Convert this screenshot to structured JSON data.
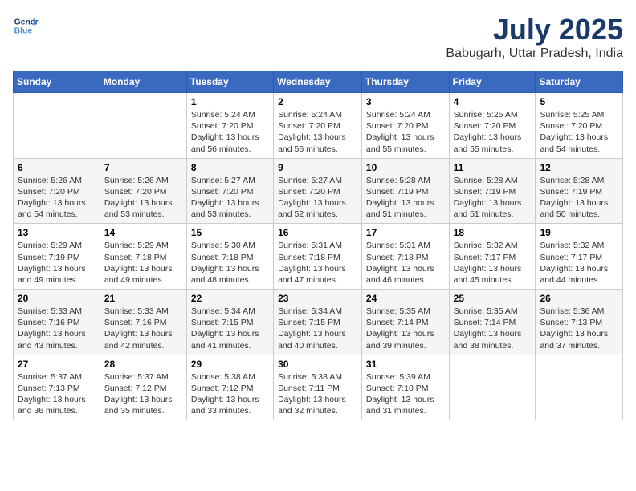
{
  "header": {
    "logo_line1": "General",
    "logo_line2": "Blue",
    "month": "July 2025",
    "location": "Babugarh, Uttar Pradesh, India"
  },
  "weekdays": [
    "Sunday",
    "Monday",
    "Tuesday",
    "Wednesday",
    "Thursday",
    "Friday",
    "Saturday"
  ],
  "weeks": [
    [
      {
        "day": "",
        "info": ""
      },
      {
        "day": "",
        "info": ""
      },
      {
        "day": "1",
        "info": "Sunrise: 5:24 AM\nSunset: 7:20 PM\nDaylight: 13 hours and 56 minutes."
      },
      {
        "day": "2",
        "info": "Sunrise: 5:24 AM\nSunset: 7:20 PM\nDaylight: 13 hours and 56 minutes."
      },
      {
        "day": "3",
        "info": "Sunrise: 5:24 AM\nSunset: 7:20 PM\nDaylight: 13 hours and 55 minutes."
      },
      {
        "day": "4",
        "info": "Sunrise: 5:25 AM\nSunset: 7:20 PM\nDaylight: 13 hours and 55 minutes."
      },
      {
        "day": "5",
        "info": "Sunrise: 5:25 AM\nSunset: 7:20 PM\nDaylight: 13 hours and 54 minutes."
      }
    ],
    [
      {
        "day": "6",
        "info": "Sunrise: 5:26 AM\nSunset: 7:20 PM\nDaylight: 13 hours and 54 minutes."
      },
      {
        "day": "7",
        "info": "Sunrise: 5:26 AM\nSunset: 7:20 PM\nDaylight: 13 hours and 53 minutes."
      },
      {
        "day": "8",
        "info": "Sunrise: 5:27 AM\nSunset: 7:20 PM\nDaylight: 13 hours and 53 minutes."
      },
      {
        "day": "9",
        "info": "Sunrise: 5:27 AM\nSunset: 7:20 PM\nDaylight: 13 hours and 52 minutes."
      },
      {
        "day": "10",
        "info": "Sunrise: 5:28 AM\nSunset: 7:19 PM\nDaylight: 13 hours and 51 minutes."
      },
      {
        "day": "11",
        "info": "Sunrise: 5:28 AM\nSunset: 7:19 PM\nDaylight: 13 hours and 51 minutes."
      },
      {
        "day": "12",
        "info": "Sunrise: 5:28 AM\nSunset: 7:19 PM\nDaylight: 13 hours and 50 minutes."
      }
    ],
    [
      {
        "day": "13",
        "info": "Sunrise: 5:29 AM\nSunset: 7:19 PM\nDaylight: 13 hours and 49 minutes."
      },
      {
        "day": "14",
        "info": "Sunrise: 5:29 AM\nSunset: 7:18 PM\nDaylight: 13 hours and 49 minutes."
      },
      {
        "day": "15",
        "info": "Sunrise: 5:30 AM\nSunset: 7:18 PM\nDaylight: 13 hours and 48 minutes."
      },
      {
        "day": "16",
        "info": "Sunrise: 5:31 AM\nSunset: 7:18 PM\nDaylight: 13 hours and 47 minutes."
      },
      {
        "day": "17",
        "info": "Sunrise: 5:31 AM\nSunset: 7:18 PM\nDaylight: 13 hours and 46 minutes."
      },
      {
        "day": "18",
        "info": "Sunrise: 5:32 AM\nSunset: 7:17 PM\nDaylight: 13 hours and 45 minutes."
      },
      {
        "day": "19",
        "info": "Sunrise: 5:32 AM\nSunset: 7:17 PM\nDaylight: 13 hours and 44 minutes."
      }
    ],
    [
      {
        "day": "20",
        "info": "Sunrise: 5:33 AM\nSunset: 7:16 PM\nDaylight: 13 hours and 43 minutes."
      },
      {
        "day": "21",
        "info": "Sunrise: 5:33 AM\nSunset: 7:16 PM\nDaylight: 13 hours and 42 minutes."
      },
      {
        "day": "22",
        "info": "Sunrise: 5:34 AM\nSunset: 7:15 PM\nDaylight: 13 hours and 41 minutes."
      },
      {
        "day": "23",
        "info": "Sunrise: 5:34 AM\nSunset: 7:15 PM\nDaylight: 13 hours and 40 minutes."
      },
      {
        "day": "24",
        "info": "Sunrise: 5:35 AM\nSunset: 7:14 PM\nDaylight: 13 hours and 39 minutes."
      },
      {
        "day": "25",
        "info": "Sunrise: 5:35 AM\nSunset: 7:14 PM\nDaylight: 13 hours and 38 minutes."
      },
      {
        "day": "26",
        "info": "Sunrise: 5:36 AM\nSunset: 7:13 PM\nDaylight: 13 hours and 37 minutes."
      }
    ],
    [
      {
        "day": "27",
        "info": "Sunrise: 5:37 AM\nSunset: 7:13 PM\nDaylight: 13 hours and 36 minutes."
      },
      {
        "day": "28",
        "info": "Sunrise: 5:37 AM\nSunset: 7:12 PM\nDaylight: 13 hours and 35 minutes."
      },
      {
        "day": "29",
        "info": "Sunrise: 5:38 AM\nSunset: 7:12 PM\nDaylight: 13 hours and 33 minutes."
      },
      {
        "day": "30",
        "info": "Sunrise: 5:38 AM\nSunset: 7:11 PM\nDaylight: 13 hours and 32 minutes."
      },
      {
        "day": "31",
        "info": "Sunrise: 5:39 AM\nSunset: 7:10 PM\nDaylight: 13 hours and 31 minutes."
      },
      {
        "day": "",
        "info": ""
      },
      {
        "day": "",
        "info": ""
      }
    ]
  ]
}
